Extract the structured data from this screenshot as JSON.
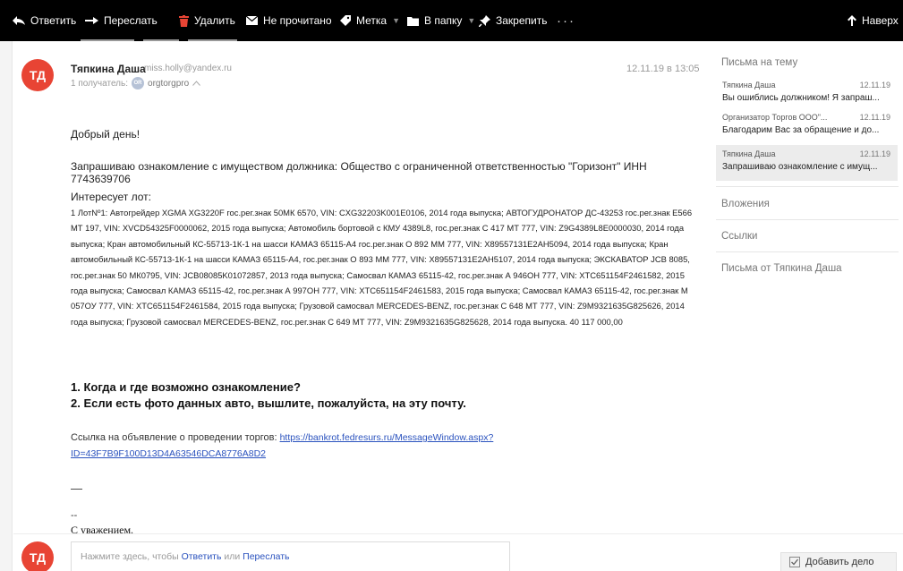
{
  "toolbar": {
    "reply": "Ответить",
    "forward": "Переслать",
    "delete": "Удалить",
    "unread": "Не прочитано",
    "label": "Метка",
    "to_folder": "В папку",
    "pin": "Закрепить",
    "more": "···",
    "up": "Наверх"
  },
  "message": {
    "avatar_initials": "ТД",
    "sender_name": "Тяпкина Даша",
    "sender_email": "miss.holly@yandex.ru",
    "recipients_label": "1 получатель:",
    "recipient_badge": "OR",
    "recipient_name": "orgtorgpro",
    "date": "12.11.19 в 13:05",
    "greeting": "Добрый день!",
    "request": "Запрашиваю ознакомление с имуществом должника: Общество с ограниченной ответственностью \"Горизонт\" ИНН 7743639706",
    "lot_title": "Интересует лот:",
    "lot_text": "1 ЛотNº1: Автогрейдер XGMA XG3220F гос.рег.знак 50МК 6570, VIN: CXG32203K001E0106, 2014 года выпуска; АВТОГУДРОНАТОР ДС-43253 гос.рег.знак Е566 МТ 197, VIN: XVCD54325F0000062, 2015 года выпуска; Автомобиль бортовой с КМУ 4389L8, гос.рег.знак С 417 МТ 777, VIN: Z9G4389L8E0000030, 2014 года выпуска; Кран автомобильный КС-55713-1К-1 на шасси КАМАЗ 65115-А4 гос.рег.знак О 892 ММ 777, VIN: X89557131E2AH5094, 2014 года выпуска; Кран автомобильный КС-55713-1К-1 на шасси КАМАЗ 65115-А4, гос.рег.знак О 893 ММ 777, VIN: X89557131E2AH5107, 2014 года выпуска; ЭКСКАВАТОР JCB 8085, гос.рег.знак 50 МК0795, VIN: JCB08085K01072857, 2013 года выпуска; Самосвал КАМАЗ 65115-42, гос.рег.знак А 946ОН 777, VIN: XTC651154F2461582, 2015 года выпуска; Самосвал КАМАЗ 65115-42, гос.рег.знак А 997ОН 777, VIN: XTC651154F2461583, 2015 года выпуска; Самосвал КАМАЗ 65115-42, гос.рег.знак М 057ОУ 777, VIN: XTC651154F2461584, 2015 года выпуска; Грузовой самосвал MERCEDES-BENZ, гос.рег.знак С 648 МТ 777, VIN: Z9M9321635G825626, 2014 года выпуска; Грузовой самосвал MERCEDES-BENZ, гос.рег.знак С 649 МТ 777, VIN: Z9M9321635G825628, 2014 года выпуска. 40 117 000,00",
    "question_1": "1. Когда и где возможно ознакомление?",
    "question_2": "2. Если есть фото данных авто, вышлите, пожалуйста, на эту почту.",
    "link_prefix": "Ссылка на объявление о проведении торгов:",
    "link_url": "https://bankrot.fedresurs.ru/MessageWindow.aspx?ID=43F7B9F100D13D4A63546DCA8776A8D2",
    "dash": "—",
    "dashdash": "--",
    "regards": "С уважением."
  },
  "reply_bar": {
    "prefix": "Нажмите здесь, чтобы",
    "reply_link": "Ответить",
    "or": "или",
    "forward_link": "Переслать",
    "add_task": "Добавить дело"
  },
  "sidebar": {
    "title": "Письма на тему",
    "threads": [
      {
        "from": "Тяпкина Даша",
        "date": "12.11.19",
        "subject": "Вы ошиблись должником! Я запраш..."
      },
      {
        "from": "Организатор Торгов ООО\"...",
        "date": "12.11.19",
        "subject": "Благодарим Вас за обращение и до..."
      },
      {
        "from": "Тяпкина Даша",
        "date": "12.11.19",
        "subject": "Запрашиваю ознакомление с имущ..."
      }
    ],
    "attachments": "Вложения",
    "links": "Ссылки",
    "letters_from": "Письма от Тяпкина Даша"
  },
  "colors": {
    "accent_link": "#2a52be",
    "avatar": "#e84434",
    "toolbar_bg": "#000000"
  },
  "icons": [
    "reply-arrow-icon",
    "forward-arrow-icon",
    "trash-icon",
    "envelope-icon",
    "tag-icon",
    "folder-icon",
    "pin-icon",
    "up-arrow-icon",
    "checkbox-icon"
  ]
}
